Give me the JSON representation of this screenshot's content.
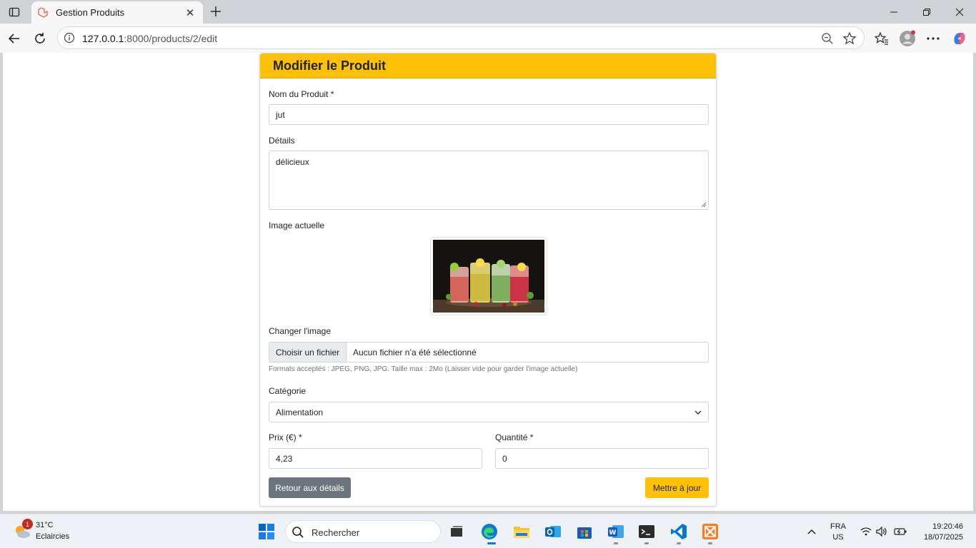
{
  "browser": {
    "tab_title": "Gestion Produits",
    "url_host": "127.0.0.1",
    "url_path": ":8000/products/2/edit"
  },
  "form": {
    "title": "Modifier le Produit",
    "name_label": "Nom du Produit *",
    "name_value": "jut",
    "details_label": "Détails",
    "details_value": "délicieux",
    "current_image_label": "Image actuelle",
    "change_image_label": "Changer l'image",
    "choose_file_label": "Choisir un fichier",
    "no_file_label": "Aucun fichier n’a été sélectionné",
    "file_hint": "Formats acceptés : JPEG, PNG, JPG. Taille max : 2Mo (Laisser vide pour garder l'image actuelle)",
    "category_label": "Catégorie",
    "category_value": "Alimentation",
    "price_label": "Prix (€) *",
    "price_value": "4,23",
    "quantity_label": "Quantité *",
    "quantity_value": "0",
    "back_button": "Retour aux détails",
    "submit_button": "Mettre à jour",
    "accent_color": "#ffc107",
    "secondary_color": "#6c757d"
  },
  "taskbar": {
    "weather_badge": "1",
    "weather_temp": "31°C",
    "weather_condition": "Eclaircies",
    "search_placeholder": "Rechercher",
    "lang_primary": "FRA",
    "lang_secondary": "US",
    "time": "19:20:46",
    "date": "18/07/2025"
  }
}
